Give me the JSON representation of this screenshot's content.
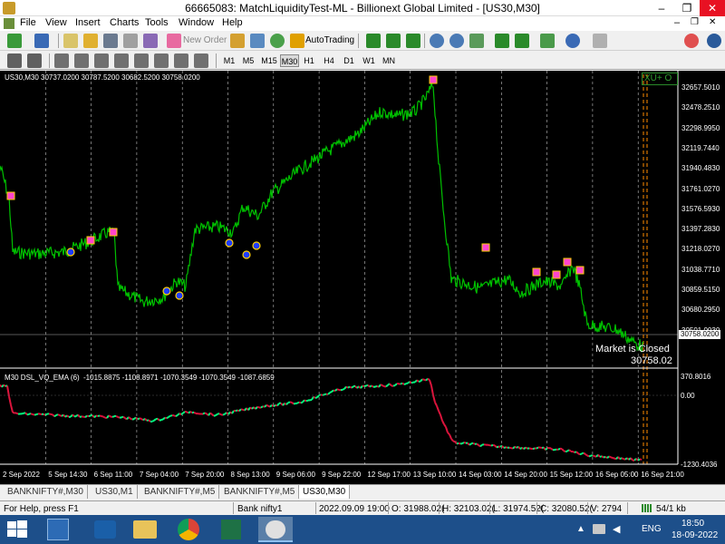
{
  "window": {
    "title": "66665083: MatchLiquidityTest-ML - Billionext Global Limited - [US30,M30]",
    "minimize": "–",
    "restore": "❐",
    "close": "✕",
    "doc_minimize": "–",
    "doc_restore": "❐",
    "doc_close": "✕"
  },
  "menu": {
    "items": [
      "File",
      "View",
      "Insert",
      "Charts",
      "Tools",
      "Window",
      "Help"
    ]
  },
  "toolbar": {
    "new_order": "New Order",
    "autotrading": "AutoTrading",
    "timeframes": [
      "M1",
      "M5",
      "M15",
      "M30",
      "H1",
      "H4",
      "D1",
      "W1",
      "MN"
    ],
    "active_timeframe": "M30"
  },
  "chart": {
    "info": "US30,M30  30737.0200 30787.5200 30682.5200 30758.0200",
    "price_axis": [
      "32657.5010",
      "32478.2510",
      "32298.9950",
      "32119.7440",
      "31940.4830",
      "31761.0270",
      "31576.5930",
      "31397.2830",
      "31218.0270",
      "31038.7710",
      "30859.5150",
      "30680.2950",
      "30501.0030"
    ],
    "current_price": "30758.0200",
    "market_closed": "Market is Closed",
    "market_price": "30758.02",
    "ea_badge": "XU+ O",
    "indicator_label": "M30 DSL_VQ_EMA (6)",
    "indicator_values": "-1015.8875  -1108.8971  -1070.3549  -1070.3549  -1087.6859",
    "indicator_axis": [
      "370.8016",
      "0.00",
      "-1230.4036"
    ],
    "time_axis": [
      "2 Sep 2022",
      "5 Sep 14:30",
      "6 Sep 11:00",
      "7 Sep 04:00",
      "7 Sep 20:00",
      "8 Sep 13:00",
      "9 Sep 06:00",
      "9 Sep 22:00",
      "12 Sep 17:00",
      "13 Sep 10:00",
      "14 Sep 03:00",
      "14 Sep 20:00",
      "15 Sep 12:00",
      "16 Sep 05:00",
      "16 Sep 21:00"
    ]
  },
  "tabs": [
    "BANKNIFTY#,M30",
    "US30,M1",
    "BANKNIFTY#,M5",
    "BANKNIFTY#,M5",
    "US30,M30"
  ],
  "status": {
    "help": "For Help, press F1",
    "profile": "Bank nifty1",
    "datetime": "2022.09.09 19:00",
    "open": "O: 31988.02(",
    "high": "H: 32103.02(",
    "low": "L: 31974.52(",
    "close": "C: 32080.52(",
    "volume": "V: 2794",
    "traffic": "54/1 kb"
  },
  "taskbar": {
    "lang": "ENG",
    "time": "18:50",
    "date": "18-09-2022"
  },
  "colors": {
    "price_line": "#00c000",
    "osc_up": "#00ff7f",
    "osc_down": "#dc143c",
    "grid": "#c0c0c0",
    "close_line": "#ff8c00"
  }
}
